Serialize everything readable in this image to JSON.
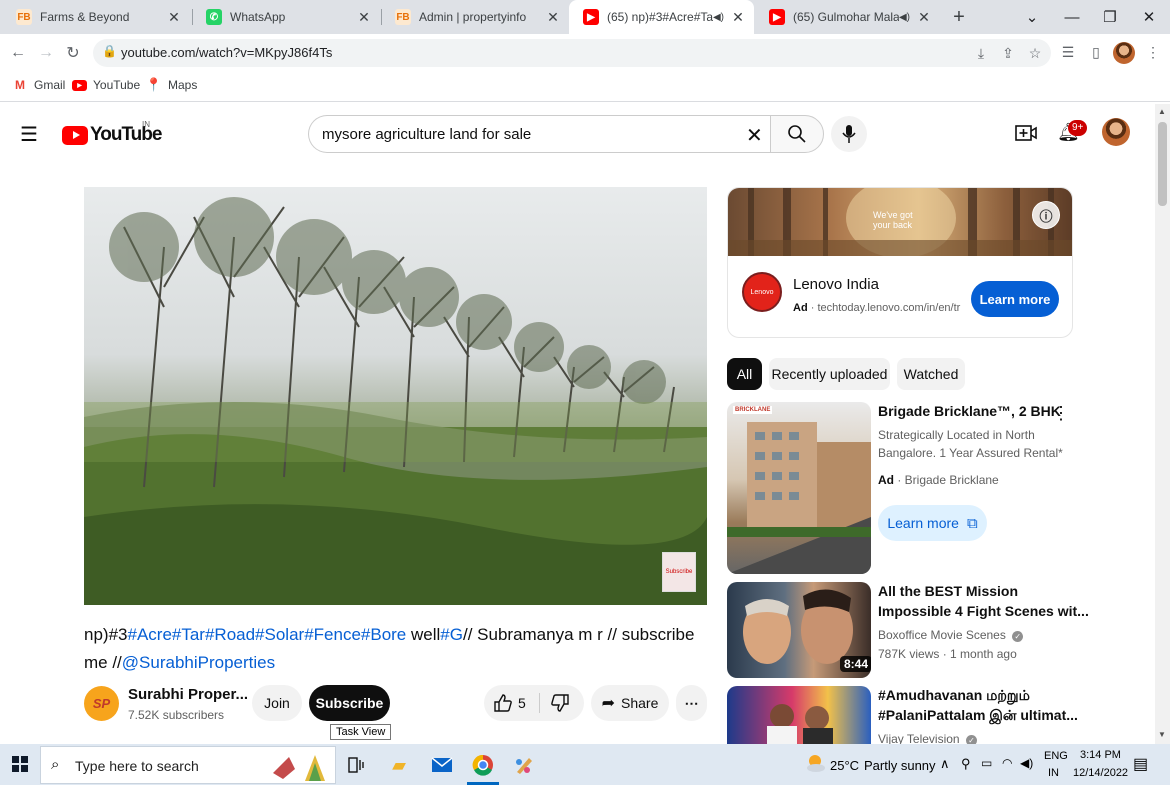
{
  "browser": {
    "tabs": [
      {
        "title": "Farms & Beyond",
        "favicon": "FB"
      },
      {
        "title": "WhatsApp",
        "favicon": "wa"
      },
      {
        "title": "Admin | propertyinfo",
        "favicon": "FB"
      },
      {
        "title": "(65) np)#3#Acre#Tar#Ro",
        "favicon": "yt",
        "active": true,
        "audio": true
      },
      {
        "title": "(65) Gulmohar Malare O",
        "favicon": "yt",
        "audio": true
      }
    ],
    "new_tab": "+",
    "url": "youtube.com/watch?v=MKpyJ86f4Ts",
    "bookmarks": [
      {
        "label": "Gmail"
      },
      {
        "label": "YouTube"
      },
      {
        "label": "Maps"
      }
    ]
  },
  "youtube": {
    "logo_text": "YouTube",
    "country": "IN",
    "search_value": "mysore agriculture land for sale",
    "notifications": "9+"
  },
  "video": {
    "title_parts": [
      {
        "text": "np)#3",
        "link": false
      },
      {
        "text": "#Acre#Tar#Road#Solar#Fence#Bore",
        "link": true
      },
      {
        "text": " well",
        "link": false
      },
      {
        "text": "#G",
        "link": true
      },
      {
        "text": "// Subramanya m r // subscribe me //",
        "link": false
      },
      {
        "text": "@SurabhiProperties",
        "link": true
      }
    ],
    "overlay_badge": "Subscribe",
    "channel_name": "Surabhi Proper...",
    "channel_initials": "SP",
    "subscribers": "7.52K subscribers",
    "join_label": "Join",
    "subscribe_label": "Subscribe",
    "likes": "5",
    "share_label": "Share",
    "tooltip": "Task View"
  },
  "sidebar": {
    "ad": {
      "banner_text": "We've got your back",
      "advertiser": "Lenovo India",
      "advertiser_logo": "Lenovo",
      "ad_label": "Ad",
      "ad_url": "techtoday.lenovo.com/in/en/tru",
      "cta": "Learn more"
    },
    "chips": [
      "All",
      "Recently uploaded",
      "Watched"
    ],
    "items": [
      {
        "title_lines": [
          "Brigade Bricklane™, 2 BHK"
        ],
        "desc_lines": [
          "Strategically Located in North",
          "Bangalore. 1 Year Assured Rental*"
        ],
        "ad_label": "Ad",
        "channel": "Brigade Bricklane",
        "cta": "Learn more",
        "thumb_badge": "BRICKLANE"
      },
      {
        "title_lines": [
          "All the BEST Mission",
          "Impossible 4 Fight Scenes wit..."
        ],
        "channel": "Boxoffice Movie Scenes",
        "meta": "787K views · 1 month ago",
        "duration": "8:44"
      },
      {
        "title_lines": [
          "#Amudhavanan மற்றும்",
          "#PalaniPattalam இன் ultimat..."
        ],
        "channel": "Vijay Television"
      }
    ]
  },
  "taskbar": {
    "search_placeholder": "Type here to search",
    "weather_temp": "25°C",
    "weather_desc": "Partly sunny",
    "lang_top": "ENG",
    "lang_bottom": "IN",
    "time": "3:14 PM",
    "date": "12/14/2022"
  },
  "colors": {
    "yt_red": "#ff0000",
    "link_blue": "#065fd4",
    "cta_blue": "#065fd4",
    "tab_bar": "#dee1e6",
    "taskbar": "#dfe8f2"
  }
}
